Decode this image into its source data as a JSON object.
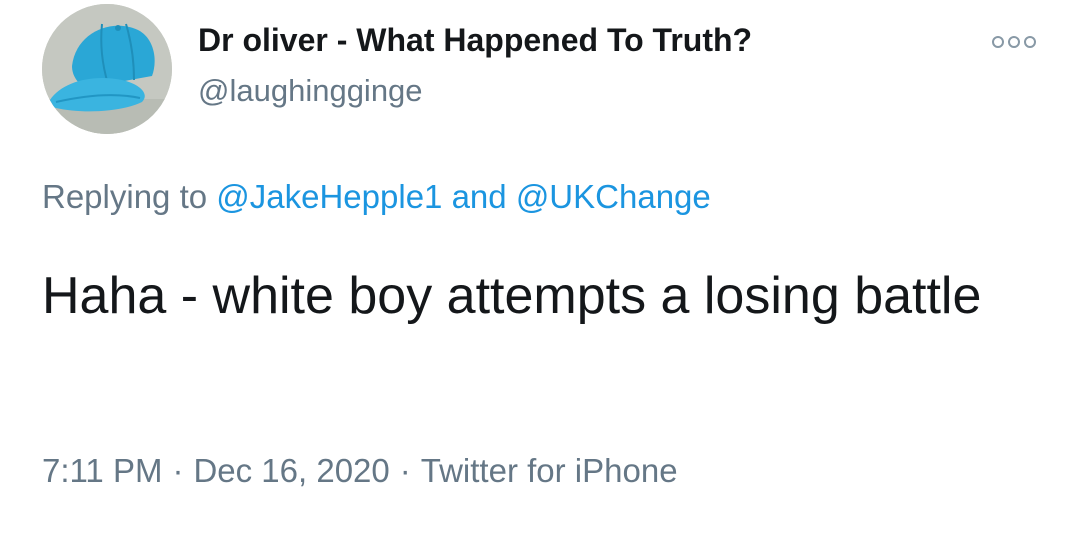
{
  "author": {
    "display_name": "Dr oliver - What Happened To Truth?",
    "handle": "@laughingginge",
    "avatar_icon": "blue-cap-avatar"
  },
  "more_menu": {
    "icon": "more-options-icon"
  },
  "reply_context": {
    "prefix": "Replying to ",
    "mention_1": "@JakeHepple1",
    "connector": " and ",
    "mention_2": "@UKChange"
  },
  "tweet": {
    "text": "Haha - white boy attempts a losing battle"
  },
  "meta": {
    "time": "7:11 PM",
    "separator": "·",
    "date": "Dec 16, 2020",
    "source": "Twitter for iPhone"
  },
  "colors": {
    "text_primary": "#14171a",
    "text_secondary": "#657786",
    "link": "#1b95e0",
    "cap_blue": "#2aa7d6"
  }
}
